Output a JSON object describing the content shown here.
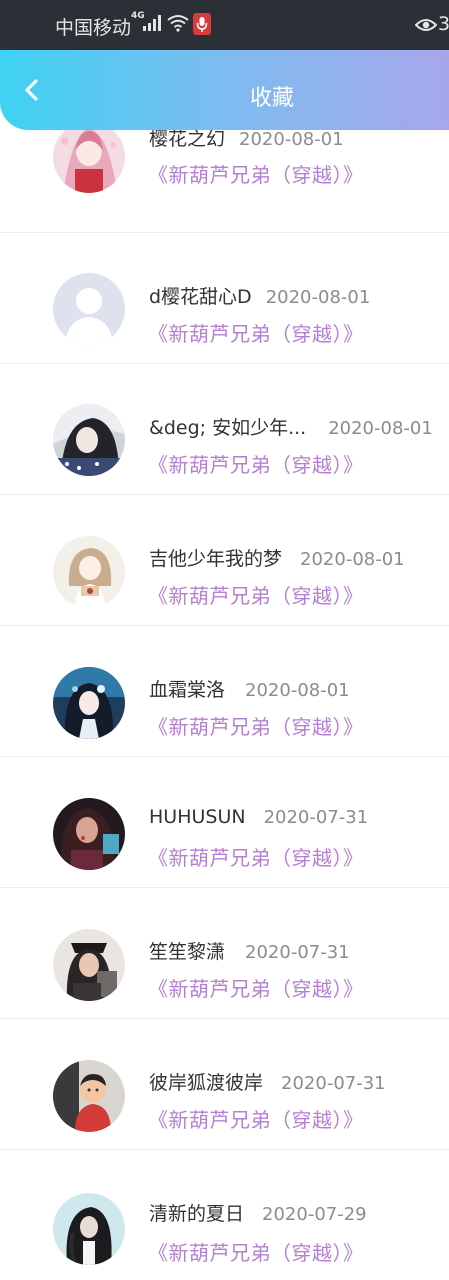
{
  "status_bar": {
    "carrier": "中国移动",
    "network": "4G",
    "right_text": "3"
  },
  "header": {
    "title": "收藏"
  },
  "items": [
    {
      "name": "樱花之幻",
      "date": "2020-08-01",
      "book": "《新葫芦兄弟（穿越）》"
    },
    {
      "name": "d樱花甜心D",
      "date": "2020-08-01",
      "book": "《新葫芦兄弟（穿越）》"
    },
    {
      "name": "&deg; 安如少年...",
      "date": "2020-08-01",
      "book": "《新葫芦兄弟（穿越）》"
    },
    {
      "name": "吉他少年我的梦",
      "date": "2020-08-01",
      "book": "《新葫芦兄弟（穿越）》"
    },
    {
      "name": "血霜棠洛",
      "date": "2020-08-01",
      "book": "《新葫芦兄弟（穿越）》"
    },
    {
      "name": "HUHUSUN",
      "date": "2020-07-31",
      "book": "《新葫芦兄弟（穿越）》"
    },
    {
      "name": "笙笙黎潇",
      "date": "2020-07-31",
      "book": "《新葫芦兄弟（穿越）》"
    },
    {
      "name": "彼岸狐渡彼岸",
      "date": "2020-07-31",
      "book": "《新葫芦兄弟（穿越）》"
    },
    {
      "name": "清新的夏日",
      "date": "2020-07-29",
      "book": "《新葫芦兄弟（穿越）》"
    }
  ],
  "colors": {
    "header_gradient_start": "#3ed2f2",
    "header_gradient_end": "#a7a6ec",
    "book_title": "#b77fd4"
  }
}
